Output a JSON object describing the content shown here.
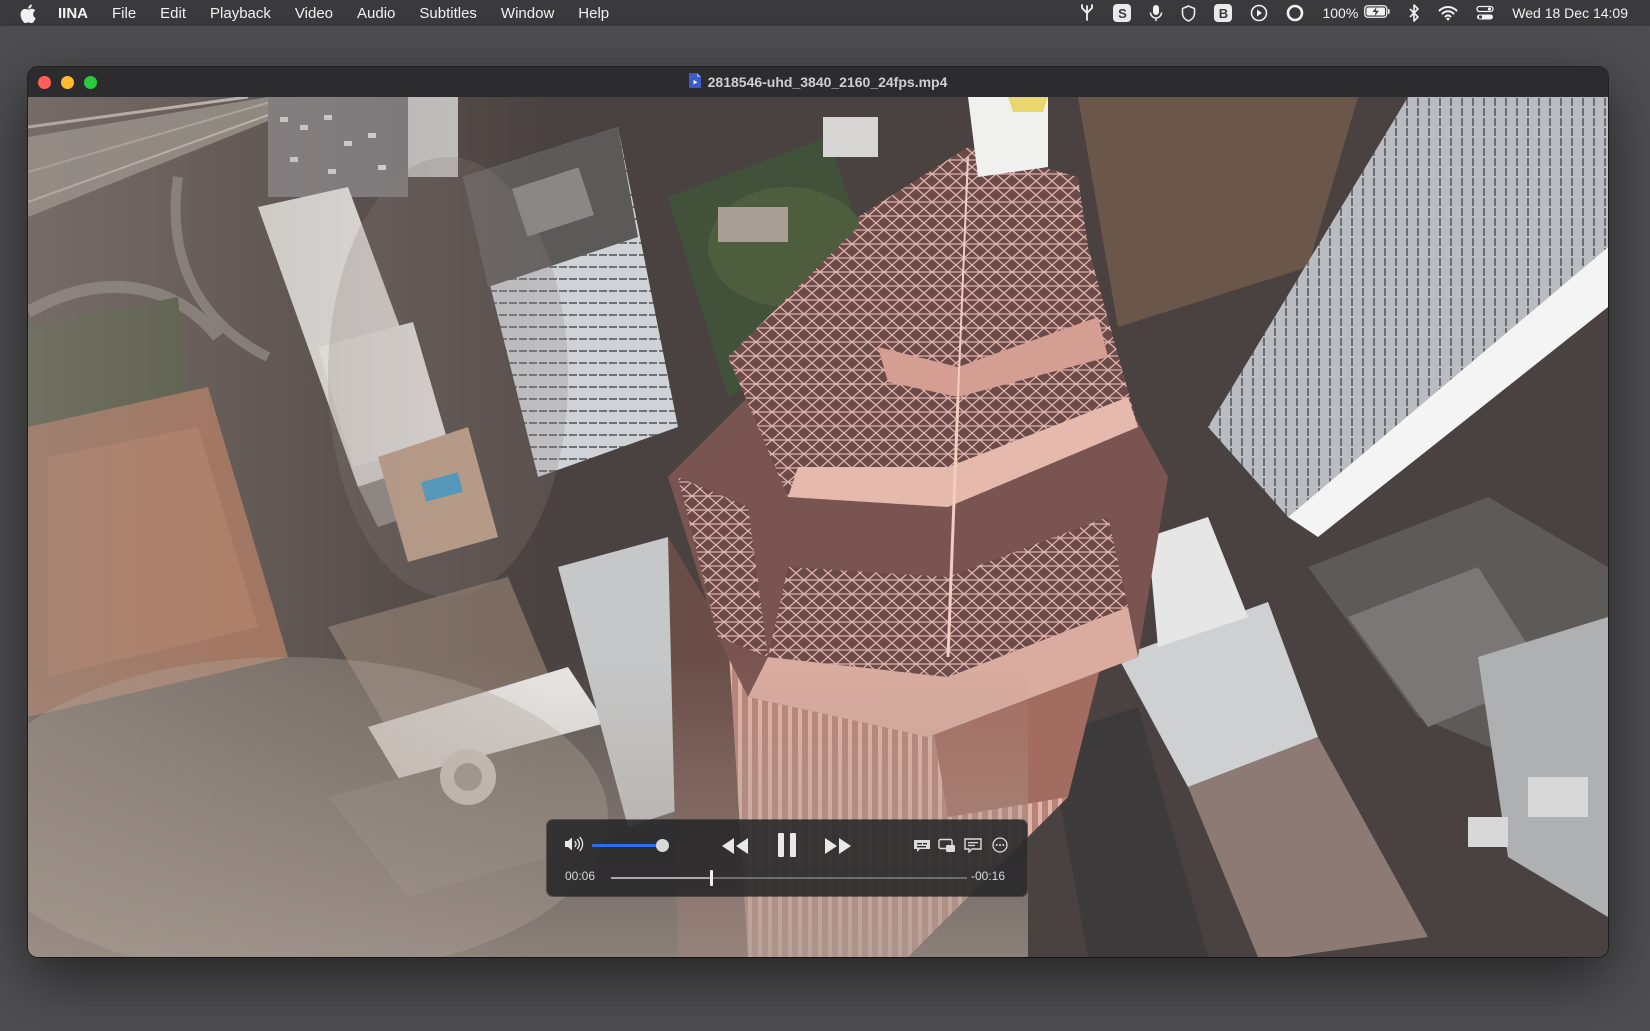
{
  "menubar": {
    "app_name": "IINA",
    "items": [
      "File",
      "Edit",
      "Playback",
      "Video",
      "Audio",
      "Subtitles",
      "Window",
      "Help"
    ],
    "status": {
      "skype_letter": "S",
      "b_letter": "B",
      "battery": "100%",
      "clock": "Wed 18 Dec  14:09"
    }
  },
  "window": {
    "title": "2818546-uhd_3840_2160_24fps.mp4",
    "traffic_colors": {
      "close": "#ff5f57",
      "minimize": "#febc2e",
      "zoom": "#28c840"
    }
  },
  "player": {
    "elapsed": "00:06",
    "remaining": "-00:16",
    "volume_fraction": 1.0,
    "progress_fraction": 0.28,
    "accent_color": "#2f6cf2",
    "state": "playing"
  }
}
